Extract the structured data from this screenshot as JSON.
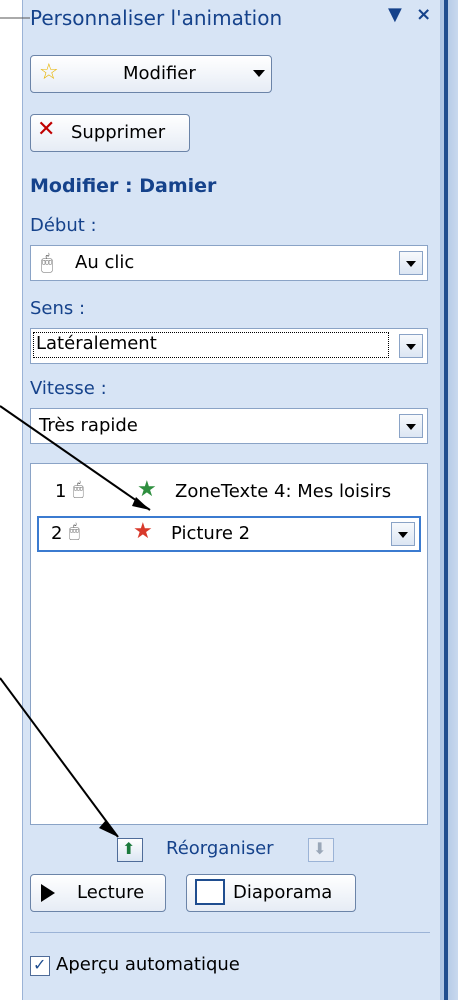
{
  "pane": {
    "title": "Personnaliser l'animation",
    "dropdown_icon": "▼",
    "close_icon": "×"
  },
  "buttons": {
    "modify": "Modifier",
    "remove": "Supprimer",
    "play": "Lecture",
    "slideshow": "Diaporama"
  },
  "section": {
    "heading": "Modifier : Damier"
  },
  "fields": {
    "start": {
      "label": "Début :",
      "value": "Au clic"
    },
    "direction": {
      "label": "Sens :",
      "value": "Latéralement"
    },
    "speed": {
      "label": "Vitesse :",
      "value": "Très rapide"
    }
  },
  "animation_list": [
    {
      "number": "1",
      "text": "ZoneTexte 4: Mes loisirs"
    },
    {
      "number": "2",
      "text": "Picture 2"
    }
  ],
  "reorder": {
    "label": "Réorganiser"
  },
  "auto_preview": {
    "label": "Aperçu automatique",
    "checked": true
  },
  "colors": {
    "pane_bg": "#d7e4f5",
    "title": "#15428b",
    "accent": "#1f4d8f"
  }
}
